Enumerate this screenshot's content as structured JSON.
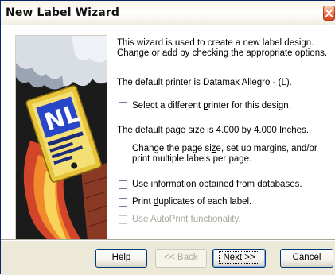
{
  "window": {
    "title": "New Label Wizard"
  },
  "intro_text": "This wizard is used to create a new label design. Change or add by checking the appropriate options.",
  "default_printer_text": "The default printer is Datamax Allegro - (L).",
  "default_page_size_text": "The default page size is 4.000 by 4.000 Inches.",
  "options": {
    "printer": {
      "pre": "Select a different ",
      "key": "p",
      "post": "rinter for this design.",
      "checked": false
    },
    "page_size": {
      "pre": "Change the page si",
      "key": "z",
      "post": "e, set up margins, and/or",
      "line2": "print multiple labels per page.",
      "checked": false
    },
    "database": {
      "pre": "Use information obtained from data",
      "key": "b",
      "post": "ases.",
      "checked": false
    },
    "duplicates": {
      "pre": "Print ",
      "key": "d",
      "post": "uplicates of each label.",
      "checked": false
    },
    "autoprint": {
      "pre": "Use ",
      "key": "A",
      "post": "utoPrint functionality.",
      "checked": false,
      "enabled": false
    }
  },
  "buttons": {
    "help": {
      "pre": "",
      "key": "H",
      "post": "elp"
    },
    "back": {
      "pre": "<< ",
      "key": "B",
      "post": "ack",
      "enabled": false
    },
    "next": {
      "pre": "",
      "key": "N",
      "post": "ext >>",
      "default": true
    },
    "cancel": {
      "label": "Cancel"
    }
  },
  "colors": {
    "title_bar": "#f7f3e5",
    "close_button": "#ec6b42",
    "illustration_tag": "#e8c43a",
    "illustration_flame": "#d3452a",
    "illustration_label_blue": "#2846c8"
  }
}
